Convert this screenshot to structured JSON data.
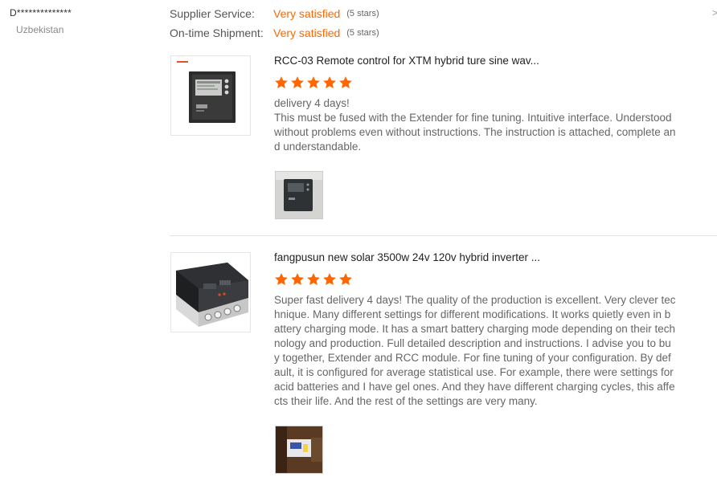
{
  "reviewer": {
    "name": "D**************",
    "country": "Uzbekistan"
  },
  "edge_mark": ">",
  "ratings": [
    {
      "label": "Supplier Service:",
      "value": "Very satisfied",
      "stars": "(5 stars)"
    },
    {
      "label": "On-time Shipment:",
      "value": "Very satisfied",
      "stars": "(5 stars)"
    }
  ],
  "colors": {
    "accent": "#ff6600",
    "star": "#ff6600"
  },
  "reviews": [
    {
      "product_title": "RCC-03 Remote control for XTM hybrid ture sine wav...",
      "stars": 5,
      "text": "delivery 4 days!\nThis must be fused with the Extender for fine tuning. Intuitive interface. Understood without problems even without instructions. The instruction is attached, complete and understandable.",
      "thumb_icon": "remote-control-product-image",
      "photo_icon": "customer-photo"
    },
    {
      "product_title": "fangpusun new solar 3500w 24v 120v hybrid inverter ...",
      "stars": 5,
      "text": "Super fast delivery 4 days! The quality of the production is excellent. Very clever technique. Many different settings for different modifications. It works quietly even in battery charging mode. It has a smart battery charging mode depending on their technology and production. Full detailed description and instructions. I advise you to buy together, Extender and RCC module. For fine tuning of your configuration. By default, it is configured for average statistical use. For example, there were settings for acid batteries and I have gel ones. And they have different charging cycles, this affects their life. And the rest of the settings are very many.",
      "thumb_icon": "inverter-product-image",
      "photo_icon": "customer-photo"
    }
  ]
}
